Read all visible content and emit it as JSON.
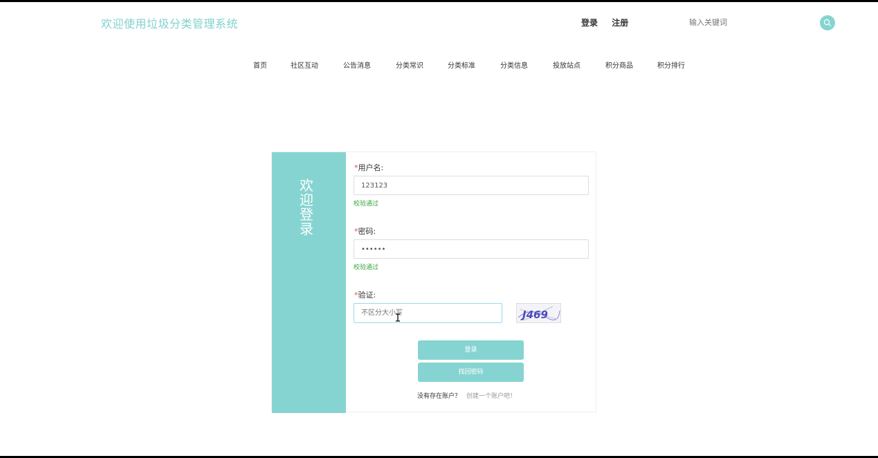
{
  "header": {
    "site_title": "欢迎使用垃圾分类管理系统",
    "login_link": "登录",
    "register_link": "注册",
    "search_placeholder": "输入关键词",
    "accent_color": "#86d4d2"
  },
  "nav": {
    "items": [
      {
        "label": "首页"
      },
      {
        "label": "社区互动"
      },
      {
        "label": "公告消息"
      },
      {
        "label": "分类常识"
      },
      {
        "label": "分类标准"
      },
      {
        "label": "分类信息"
      },
      {
        "label": "投放站点"
      },
      {
        "label": "积分商品"
      },
      {
        "label": "积分排行"
      }
    ]
  },
  "login_form": {
    "welcome_text": "欢迎登录",
    "required_mark": "*",
    "username": {
      "label": "用户名:",
      "value": "123123",
      "hint": "校验通过"
    },
    "password": {
      "label": "密码:",
      "value": "••••••",
      "hint": "校验通过"
    },
    "captcha": {
      "label": "验证:",
      "placeholder": "不区分大小写",
      "image_text": "J469"
    },
    "login_button": "登录",
    "recover_button": "找回密码",
    "no_account_text": "没有存在账户？",
    "create_account_link": "创建一个账户吧！"
  },
  "icons": {
    "search": "search-icon",
    "cursor": "text-cursor-icon"
  }
}
